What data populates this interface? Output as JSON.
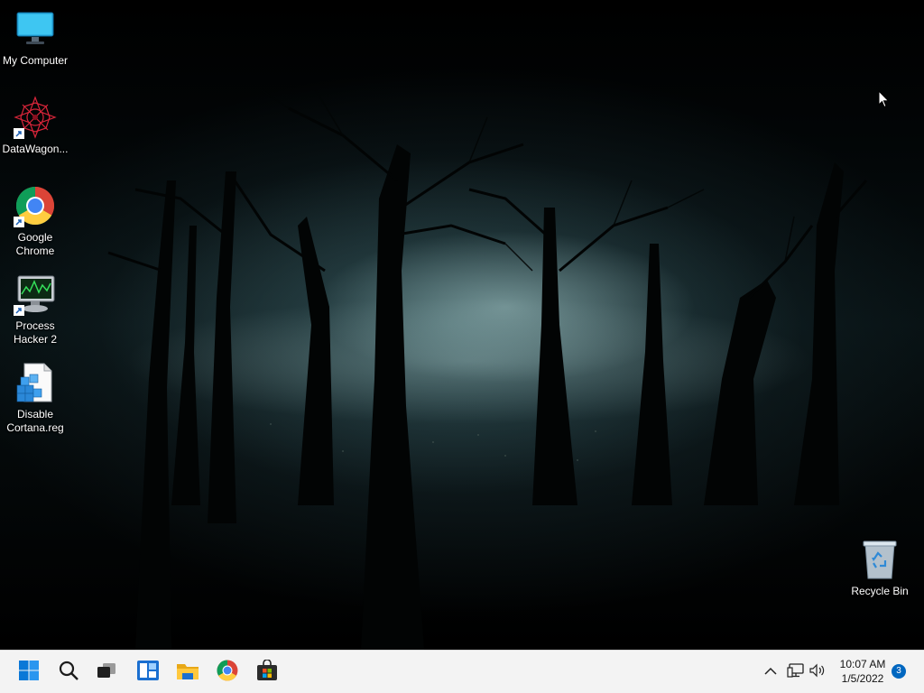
{
  "desktop": {
    "icons": [
      {
        "label": "My Computer",
        "icon": "monitor-icon",
        "shortcut": false
      },
      {
        "label": "DataWagon...",
        "icon": "datawagon-logo-icon",
        "shortcut": true
      },
      {
        "label": "Google Chrome",
        "icon": "chrome-icon",
        "shortcut": true
      },
      {
        "label": "Process Hacker 2",
        "icon": "process-hacker-icon",
        "shortcut": true
      },
      {
        "label": "Disable Cortana.reg",
        "icon": "registry-file-icon",
        "shortcut": false
      },
      {
        "label": "Recycle Bin",
        "icon": "recycle-bin-icon",
        "shortcut": false
      }
    ]
  },
  "taskbar": {
    "pinned": [
      {
        "name": "Start",
        "icon": "windows-start-icon"
      },
      {
        "name": "Search",
        "icon": "search-icon"
      },
      {
        "name": "Task View",
        "icon": "task-view-icon"
      },
      {
        "name": "Widgets",
        "icon": "widgets-icon"
      },
      {
        "name": "File Explorer",
        "icon": "folder-icon"
      },
      {
        "name": "Google Chrome",
        "icon": "chrome-icon"
      },
      {
        "name": "Microsoft Store",
        "icon": "store-icon"
      }
    ],
    "tray": {
      "icons": [
        "chevron-up-icon",
        "network-icon",
        "volume-icon"
      ],
      "time": "10:07 AM",
      "date": "1/5/2022",
      "notification_count": "3"
    }
  },
  "colors": {
    "taskbar_bg": "#f3f3f3",
    "accent": "#0067c0"
  }
}
